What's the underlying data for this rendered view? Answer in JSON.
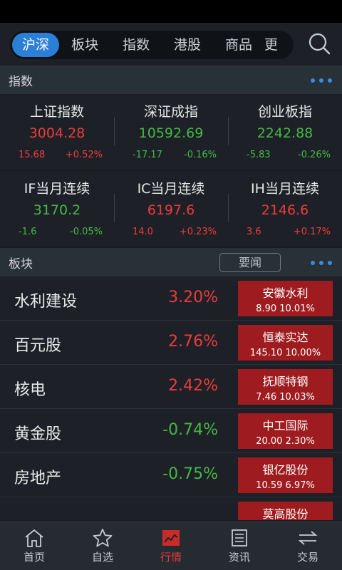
{
  "nav": {
    "tabs": [
      "沪深",
      "板块",
      "指数",
      "港股",
      "商品",
      "更"
    ]
  },
  "indices_section": {
    "title": "指数"
  },
  "indices": [
    {
      "name": "上证指数",
      "value": "3004.28",
      "change": "15.68",
      "pct": "+0.52%",
      "dir": "up"
    },
    {
      "name": "深证成指",
      "value": "10592.69",
      "change": "-17.17",
      "pct": "-0.16%",
      "dir": "down"
    },
    {
      "name": "创业板指",
      "value": "2242.88",
      "change": "-5.83",
      "pct": "-0.26%",
      "dir": "down"
    },
    {
      "name": "IF当月连续",
      "value": "3170.2",
      "change": "-1.6",
      "pct": "-0.05%",
      "dir": "down"
    },
    {
      "name": "IC当月连续",
      "value": "6197.6",
      "change": "14.0",
      "pct": "+0.23%",
      "dir": "up"
    },
    {
      "name": "IH当月连续",
      "value": "2146.6",
      "change": "3.6",
      "pct": "+0.17%",
      "dir": "up"
    }
  ],
  "blocks_section": {
    "title": "板块",
    "news_button": "要闻"
  },
  "blocks": [
    {
      "name": "水利建设",
      "pct": "3.20%",
      "dir": "up",
      "leader": "安徽水利",
      "leader_info": "8.90 10.01%"
    },
    {
      "name": "百元股",
      "pct": "2.76%",
      "dir": "up",
      "leader": "恒泰实达",
      "leader_info": "145.10 10.00%"
    },
    {
      "name": "核电",
      "pct": "2.42%",
      "dir": "up",
      "leader": "抚顺特钢",
      "leader_info": "7.46 10.03%"
    },
    {
      "name": "黄金股",
      "pct": "-0.74%",
      "dir": "down",
      "leader": "中工国际",
      "leader_info": "20.00 2.30%"
    },
    {
      "name": "房地产",
      "pct": "-0.75%",
      "dir": "down",
      "leader": "银亿股份",
      "leader_info": "10.59 6.97%"
    },
    {
      "name": "",
      "pct": "",
      "dir": "down",
      "leader": "莫高股份",
      "leader_info": ""
    }
  ],
  "tabbar": [
    {
      "label": "首页",
      "icon": "home-icon"
    },
    {
      "label": "自选",
      "icon": "star-icon"
    },
    {
      "label": "行情",
      "icon": "chart-icon"
    },
    {
      "label": "资讯",
      "icon": "news-icon"
    },
    {
      "label": "交易",
      "icon": "trade-icon"
    }
  ],
  "colors": {
    "up": "#ec3b3b",
    "down": "#45b845",
    "accent": "#2b7fd6",
    "leader_bg": "#9e1c1f"
  }
}
